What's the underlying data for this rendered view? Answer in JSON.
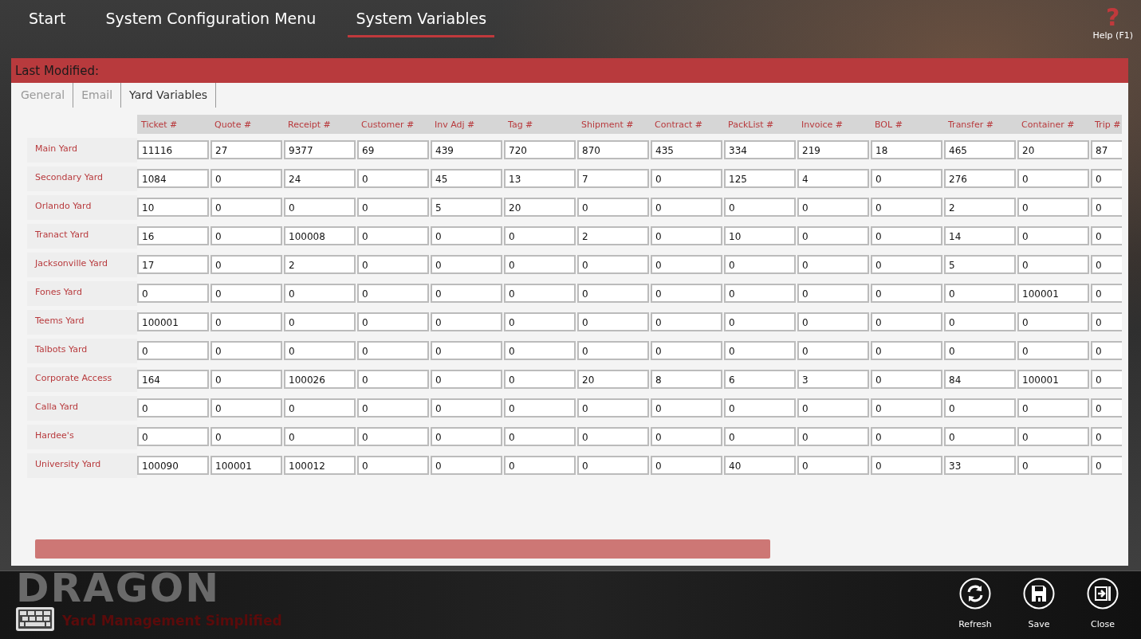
{
  "nav": [
    {
      "label": "Start",
      "selected": false
    },
    {
      "label": "System Configuration Menu",
      "selected": false
    },
    {
      "label": "System Variables",
      "selected": true
    }
  ],
  "help": {
    "icon": "?",
    "label": "Help (F1)"
  },
  "header": {
    "text": "Last Modified:"
  },
  "tabs": [
    {
      "label": "General",
      "selected": false
    },
    {
      "label": "Email",
      "selected": false
    },
    {
      "label": "Yard Variables",
      "selected": true
    }
  ],
  "table": {
    "columns": [
      "Ticket #",
      "Quote #",
      "Receipt #",
      "Customer #",
      "Inv Adj #",
      "Tag #",
      "Shipment #",
      "Contract #",
      "PackList #",
      "Invoice #",
      "BOL #",
      "Transfer #",
      "Container #",
      "Trip #"
    ],
    "rows": [
      {
        "name": "Main Yard",
        "values": [
          "11116",
          "27",
          "9377",
          "69",
          "439",
          "720",
          "870",
          "435",
          "334",
          "219",
          "18",
          "465",
          "20",
          "87"
        ]
      },
      {
        "name": "Secondary Yard",
        "values": [
          "1084",
          "0",
          "24",
          "0",
          "45",
          "13",
          "7",
          "0",
          "125",
          "4",
          "0",
          "276",
          "0",
          "0"
        ]
      },
      {
        "name": "Orlando Yard",
        "values": [
          "10",
          "0",
          "0",
          "0",
          "5",
          "20",
          "0",
          "0",
          "0",
          "0",
          "0",
          "2",
          "0",
          "0"
        ]
      },
      {
        "name": "Tranact Yard",
        "values": [
          "16",
          "0",
          "100008",
          "0",
          "0",
          "0",
          "2",
          "0",
          "10",
          "0",
          "0",
          "14",
          "0",
          "0"
        ]
      },
      {
        "name": "Jacksonville Yard",
        "values": [
          "17",
          "0",
          "2",
          "0",
          "0",
          "0",
          "0",
          "0",
          "0",
          "0",
          "0",
          "5",
          "0",
          "0"
        ]
      },
      {
        "name": "Fones Yard",
        "values": [
          "0",
          "0",
          "0",
          "0",
          "0",
          "0",
          "0",
          "0",
          "0",
          "0",
          "0",
          "0",
          "100001",
          "0"
        ]
      },
      {
        "name": "Teems Yard",
        "values": [
          "100001",
          "0",
          "0",
          "0",
          "0",
          "0",
          "0",
          "0",
          "0",
          "0",
          "0",
          "0",
          "0",
          "0"
        ]
      },
      {
        "name": "Talbots Yard",
        "values": [
          "0",
          "0",
          "0",
          "0",
          "0",
          "0",
          "0",
          "0",
          "0",
          "0",
          "0",
          "0",
          "0",
          "0"
        ]
      },
      {
        "name": "Corporate Access",
        "values": [
          "164",
          "0",
          "100026",
          "0",
          "0",
          "0",
          "20",
          "8",
          "6",
          "3",
          "0",
          "84",
          "100001",
          "0"
        ]
      },
      {
        "name": "Calla Yard",
        "values": [
          "0",
          "0",
          "0",
          "0",
          "0",
          "0",
          "0",
          "0",
          "0",
          "0",
          "0",
          "0",
          "0",
          "0"
        ]
      },
      {
        "name": "Hardee's",
        "values": [
          "0",
          "0",
          "0",
          "0",
          "0",
          "0",
          "0",
          "0",
          "0",
          "0",
          "0",
          "0",
          "0",
          "0"
        ]
      },
      {
        "name": "University Yard",
        "values": [
          "100090",
          "100001",
          "100012",
          "0",
          "0",
          "0",
          "0",
          "0",
          "40",
          "0",
          "0",
          "33",
          "0",
          "0"
        ]
      }
    ]
  },
  "logo": {
    "title": "DRAGON",
    "tagline": "Yard Management Simplified"
  },
  "actions": [
    {
      "kind": "refresh",
      "label": "Refresh"
    },
    {
      "kind": "save",
      "label": "Save"
    },
    {
      "kind": "close",
      "label": "Close"
    }
  ]
}
